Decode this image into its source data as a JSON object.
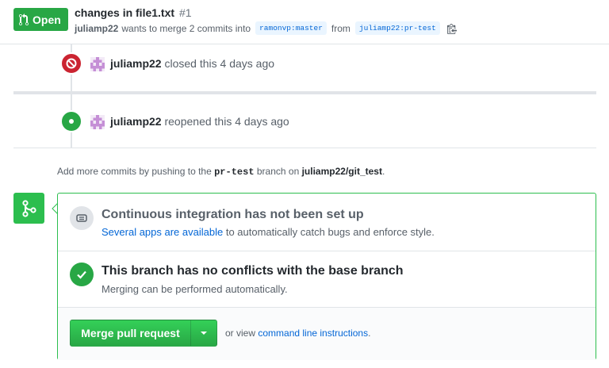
{
  "header": {
    "state_label": "Open",
    "title": "changes in file1.txt",
    "number": "#1",
    "author": "juliamp22",
    "meta_text": "wants to merge 2 commits into",
    "base_branch": "ramonvp:master",
    "from_text": "from",
    "head_branch": "juliamp22:pr-test"
  },
  "timeline": {
    "events": [
      {
        "actor": "juliamp22",
        "action": "closed this 4 days ago",
        "icon": "blocked-icon"
      },
      {
        "actor": "juliamp22",
        "action": "reopened this 4 days ago",
        "icon": "dot-icon"
      }
    ]
  },
  "hint": {
    "prefix": "Add more commits by pushing to the",
    "branch": "pr-test",
    "middle": "branch on",
    "repo": "juliamp22/git_test",
    "suffix": "."
  },
  "merge_box": {
    "ci_title": "Continuous integration has not been set up",
    "ci_link": "Several apps are available",
    "ci_text": "to automatically catch bugs and enforce style.",
    "conflict_title": "This branch has no conflicts with the base branch",
    "conflict_text": "Merging can be performed automatically.",
    "merge_button": "Merge pull request",
    "or_view": "or view",
    "cli_link": "command line instructions",
    "cli_suffix": "."
  },
  "colors": {
    "success": "#28a745",
    "danger": "#cb2431",
    "link": "#0366d6"
  }
}
